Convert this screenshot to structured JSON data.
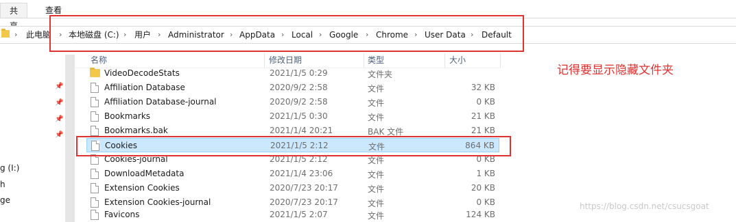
{
  "ribbon": {
    "tabs": [
      "共享",
      "查看"
    ]
  },
  "address": {
    "crumbs": [
      "此电脑",
      "本地磁盘 (C:)",
      "用户",
      "Administrator",
      "AppData",
      "Local",
      "Google",
      "Chrome",
      "User Data",
      "Default"
    ]
  },
  "nav": {
    "labels": [
      "g (I:)",
      "h",
      "ge"
    ]
  },
  "columns": {
    "name": "名称",
    "date": "修改日期",
    "type": "类型",
    "size": "大小"
  },
  "files": [
    {
      "name": "VideoDecodeStats",
      "date": "2021/1/5 0:29",
      "type": "文件夹",
      "size": "",
      "icon": "folder-icon"
    },
    {
      "name": "Affiliation Database",
      "date": "2020/9/2 2:58",
      "type": "文件",
      "size": "32 KB",
      "icon": "file-icon"
    },
    {
      "name": "Affiliation Database-journal",
      "date": "2020/9/2 2:58",
      "type": "文件",
      "size": "0 KB",
      "icon": "file-icon"
    },
    {
      "name": "Bookmarks",
      "date": "2021/1/5 0:30",
      "type": "文件",
      "size": "21 KB",
      "icon": "file-icon"
    },
    {
      "name": "Bookmarks.bak",
      "date": "2021/1/4 20:21",
      "type": "BAK 文件",
      "size": "21 KB",
      "icon": "file-icon"
    },
    {
      "name": "Cookies",
      "date": "2021/1/5 2:12",
      "type": "文件",
      "size": "864 KB",
      "icon": "file-icon",
      "selected": true
    },
    {
      "name": "Cookies-journal",
      "date": "2021/1/5 2:12",
      "type": "文件",
      "size": "0 KB",
      "icon": "file-icon"
    },
    {
      "name": "DownloadMetadata",
      "date": "2021/1/4 23:06",
      "type": "文件",
      "size": "1 KB",
      "icon": "file-icon"
    },
    {
      "name": "Extension Cookies",
      "date": "2020/7/23 20:17",
      "type": "文件",
      "size": "20 KB",
      "icon": "file-icon"
    },
    {
      "name": "Extension Cookies-journal",
      "date": "2020/7/23 20:17",
      "type": "文件",
      "size": "0 KB",
      "icon": "file-icon"
    },
    {
      "name": "Favicons",
      "date": "2021/1/5 2:07",
      "type": "文件",
      "size": "124 KB",
      "icon": "file-icon"
    }
  ],
  "annotation": "记得要显示隐藏文件夹",
  "watermark": "https://blog.csdn.net/csucsgoat",
  "colors": {
    "annotation_red": "#e03131",
    "selection_bg": "#cce8ff",
    "selection_border": "#99d1ff"
  }
}
